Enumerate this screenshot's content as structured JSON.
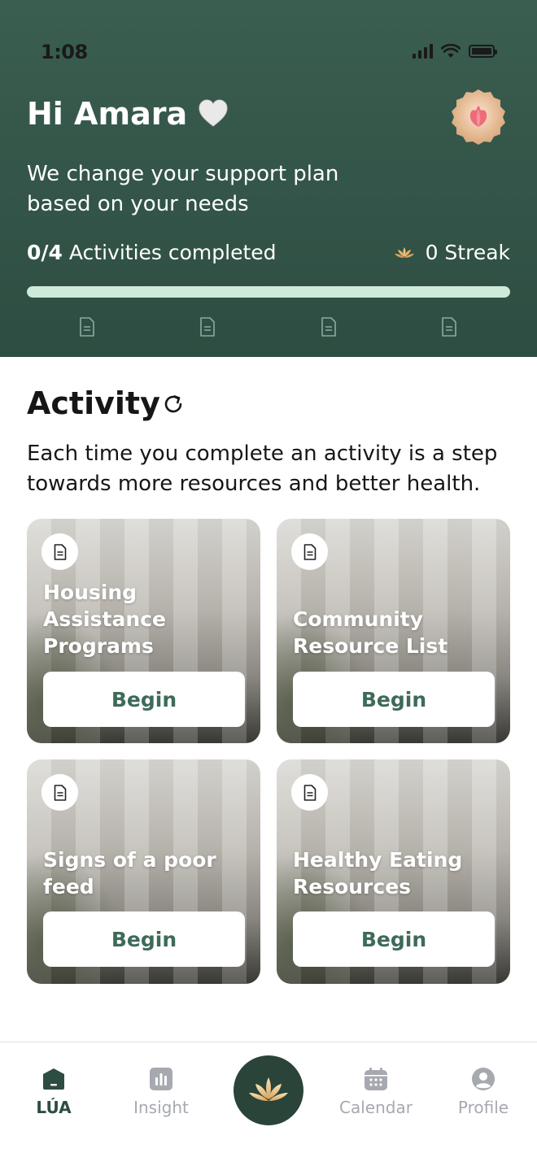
{
  "status_bar": {
    "time": "1:08"
  },
  "header": {
    "greeting": "Hi Amara",
    "subtitle": "We change your support plan based on your needs",
    "progress_count": "0/4",
    "progress_label": "Activities completed",
    "progress_value": 0,
    "streak_label": "0 Streak"
  },
  "activity": {
    "title": "Activity",
    "description": "Each time you complete an activity is a step towards more resources and better health.",
    "cards": [
      {
        "title": "Housing Assistance Programs",
        "button": "Begin"
      },
      {
        "title": "Community Resource List",
        "button": "Begin"
      },
      {
        "title": "Signs of a poor feed",
        "button": "Begin"
      },
      {
        "title": "Healthy Eating Resources",
        "button": "Begin"
      }
    ]
  },
  "nav": {
    "items": [
      {
        "label": "LÚA",
        "icon": "home-icon",
        "active": true
      },
      {
        "label": "Insight",
        "icon": "insight-icon",
        "active": false
      },
      {
        "label": "",
        "icon": "lotus-icon",
        "active": false
      },
      {
        "label": "Calendar",
        "icon": "calendar-icon",
        "active": false
      },
      {
        "label": "Profile",
        "icon": "profile-icon",
        "active": false
      }
    ]
  },
  "colors": {
    "header_bg": "#34584a",
    "progress_track": "#cfe9da",
    "accent": "#3d6b58",
    "nav_active": "#2e4d42",
    "nav_inactive": "#a6a9b0"
  }
}
